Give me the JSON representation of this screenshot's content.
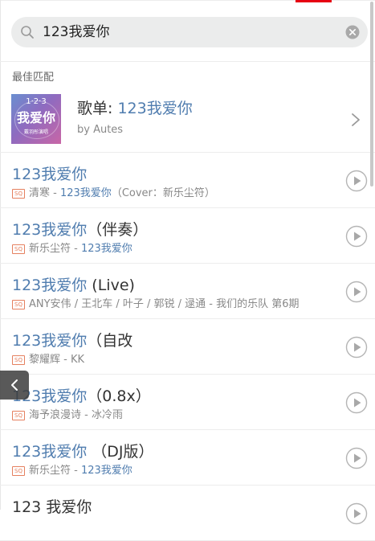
{
  "colors": {
    "accent": "#507daf",
    "brand_red": "#e60012",
    "badge": "#e5805f"
  },
  "search": {
    "query": "123我爱你",
    "icon": "search-icon",
    "clear_icon": "clear-icon"
  },
  "best_match": {
    "section_title": "最佳匹配",
    "type_label": "歌单: ",
    "title": "123我爱你",
    "by": "by Autes",
    "cover_text": "我爱你",
    "cover_num": "1·2·3",
    "cover_sub": "戴羽彤演唱"
  },
  "badge_label": "SQ",
  "songs": [
    {
      "title_hl": "123我爱你",
      "title_rest": "",
      "artist": "清寒",
      "sep": " - ",
      "album_hl": "123我爱你",
      "album_rest": "（Cover：新乐尘符）"
    },
    {
      "title_hl": "123我爱你",
      "title_rest": "（伴奏）",
      "artist": "新乐尘符",
      "sep": " - ",
      "album_hl": "123我爱你",
      "album_rest": ""
    },
    {
      "title_hl": "123我爱你",
      "title_rest": " (Live)",
      "artist": "ANY安伟 / 王北车 / 叶子 / 郭锐 / 逯通",
      "sep": " - ",
      "album_hl": "",
      "album_rest": "我们的乐队 第6期"
    },
    {
      "title_hl": "123我爱你",
      "title_rest": "（自改",
      "artist": "黎耀辉",
      "sep": " - ",
      "album_hl": "",
      "album_rest": "KK"
    },
    {
      "title_hl": "123我爱你",
      "title_rest": "（0.8x）",
      "artist": "海予浪漫诗",
      "sep": " - ",
      "album_hl": "",
      "album_rest": "冰冷雨"
    },
    {
      "title_hl": "123我爱你",
      "title_rest": " （DJ版）",
      "artist": "新乐尘符",
      "sep": " - ",
      "album_hl": "123我爱你",
      "album_rest": ""
    },
    {
      "title_hl": "",
      "title_rest": "123 我爱你",
      "artist": "",
      "sep": "",
      "album_hl": "",
      "album_rest": ""
    }
  ]
}
